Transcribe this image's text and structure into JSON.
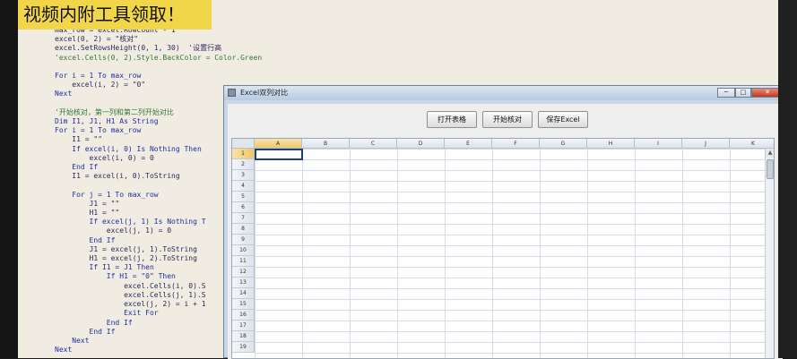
{
  "banner": "视频内附工具领取！",
  "code_lines": [
    {
      "text": "max_row = excel.RowCount - 1",
      "kind": "code"
    },
    {
      "text": "excel(0, 2) = \"核对\"",
      "kind": "code"
    },
    {
      "text": "excel.SetRowsHeight(0, 1, 30)  '设置行高",
      "kind": "code"
    },
    {
      "text": "'excel.Cells(0, 2).Style.BackColor = Color.Green",
      "kind": "cmt"
    },
    {
      "text": "",
      "kind": "code"
    },
    {
      "text": "For i = 1 To max_row",
      "kind": "kw"
    },
    {
      "text": "    excel(i, 2) = \"0\"",
      "kind": "code"
    },
    {
      "text": "Next",
      "kind": "kw"
    },
    {
      "text": "",
      "kind": "code"
    },
    {
      "text": "'开始核对，第一列和第二列开始对比",
      "kind": "cmt"
    },
    {
      "text": "Dim I1, J1, H1 As String",
      "kind": "kw"
    },
    {
      "text": "For i = 1 To max_row",
      "kind": "kw"
    },
    {
      "text": "    I1 = \"\"",
      "kind": "code"
    },
    {
      "text": "    If excel(i, 0) Is Nothing Then",
      "kind": "kw"
    },
    {
      "text": "        excel(i, 0) = 0",
      "kind": "code"
    },
    {
      "text": "    End If",
      "kind": "kw"
    },
    {
      "text": "    I1 = excel(i, 0).ToString",
      "kind": "code"
    },
    {
      "text": "",
      "kind": "code"
    },
    {
      "text": "    For j = 1 To max_row",
      "kind": "kw"
    },
    {
      "text": "        J1 = \"\"",
      "kind": "code"
    },
    {
      "text": "        H1 = \"\"",
      "kind": "code"
    },
    {
      "text": "        If excel(j, 1) Is Nothing T",
      "kind": "kw"
    },
    {
      "text": "            excel(j, 1) = 0",
      "kind": "code"
    },
    {
      "text": "        End If",
      "kind": "kw"
    },
    {
      "text": "        J1 = excel(j, 1).ToString",
      "kind": "code"
    },
    {
      "text": "        H1 = excel(j, 2).ToString",
      "kind": "code"
    },
    {
      "text": "        If I1 = J1 Then",
      "kind": "kw"
    },
    {
      "text": "            If H1 = \"0\" Then",
      "kind": "kw"
    },
    {
      "text": "                excel.Cells(i, 0).S",
      "kind": "code"
    },
    {
      "text": "                excel.Cells(j, 1).S",
      "kind": "code"
    },
    {
      "text": "                excel(j, 2) = i + 1",
      "kind": "code"
    },
    {
      "text": "                Exit For",
      "kind": "kw"
    },
    {
      "text": "            End If",
      "kind": "kw"
    },
    {
      "text": "        End If",
      "kind": "kw"
    },
    {
      "text": "    Next",
      "kind": "kw"
    },
    {
      "text": "Next",
      "kind": "kw"
    }
  ],
  "window": {
    "title": "Excel双列对比",
    "controls": {
      "minimize": "─",
      "maximize": "□",
      "close": "✕"
    }
  },
  "buttons": {
    "open": "打开表格",
    "check": "开始核对",
    "save": "保存Excel"
  },
  "grid": {
    "columns": [
      "A",
      "B",
      "C",
      "D",
      "E",
      "F",
      "G",
      "H",
      "I",
      "J",
      "K"
    ],
    "rows": [
      "1",
      "2",
      "3",
      "4",
      "5",
      "6",
      "7",
      "8",
      "9",
      "10",
      "11",
      "12",
      "13",
      "14",
      "15",
      "16",
      "17",
      "18",
      "19"
    ],
    "selected_column": "A",
    "selected_row": "1",
    "scroll_up": "▲"
  },
  "colors": {
    "banner_bg": "#f2d64a",
    "window_frame": "#c8d6e6",
    "selection_header": "#f0c66a"
  }
}
